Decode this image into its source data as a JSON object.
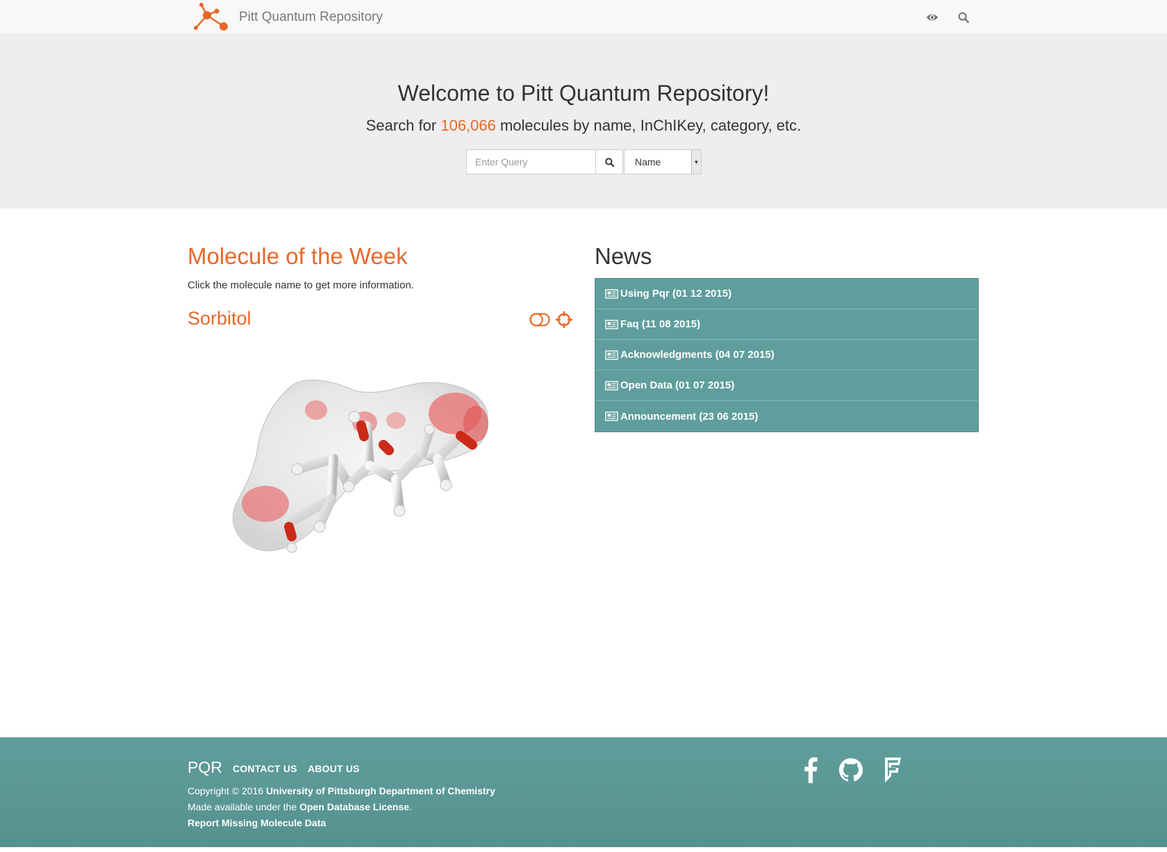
{
  "navbar": {
    "brand": "Pitt Quantum Repository",
    "icons": [
      "eye-icon",
      "search-icon"
    ]
  },
  "hero": {
    "title": "Welcome to Pitt Quantum Repository!",
    "subtitle_before": "Search for ",
    "molecule_count": "106,066",
    "subtitle_after": " molecules by name, InChIKey, category, etc.",
    "search_placeholder": "Enter Query",
    "search_value": "",
    "search_type_selected": "Name"
  },
  "molecule_of_week": {
    "heading": "Molecule of the Week",
    "description": "Click the molecule name to get more information.",
    "name": "Sorbitol",
    "controls": [
      "toggle-surface-icon",
      "center-view-icon"
    ]
  },
  "news": {
    "heading": "News",
    "items": [
      {
        "label": "Using Pqr (01 12 2015)"
      },
      {
        "label": "Faq (11 08 2015)"
      },
      {
        "label": "Acknowledgments (04 07 2015)"
      },
      {
        "label": "Open Data (01 07 2015)"
      },
      {
        "label": "Announcement (23 06 2015)"
      }
    ]
  },
  "footer": {
    "brand": "PQR",
    "links": [
      "Contact Us",
      "About Us"
    ],
    "copyright_prefix": "Copyright © 2016 ",
    "copyright_org": "University of Pittsburgh Department of Chemistry",
    "license_prefix": "Made available under the ",
    "license_name": "Open Database License",
    "license_suffix": ".",
    "report_link": "Report Missing Molecule Data",
    "social_icons": [
      "facebook-icon",
      "github-icon",
      "foursquare-icon"
    ]
  },
  "colors": {
    "accent": "#e8682a",
    "teal": "#5f9e9c",
    "hero_bg": "#eeeeee",
    "navbar_bg": "#f8f8f8"
  }
}
